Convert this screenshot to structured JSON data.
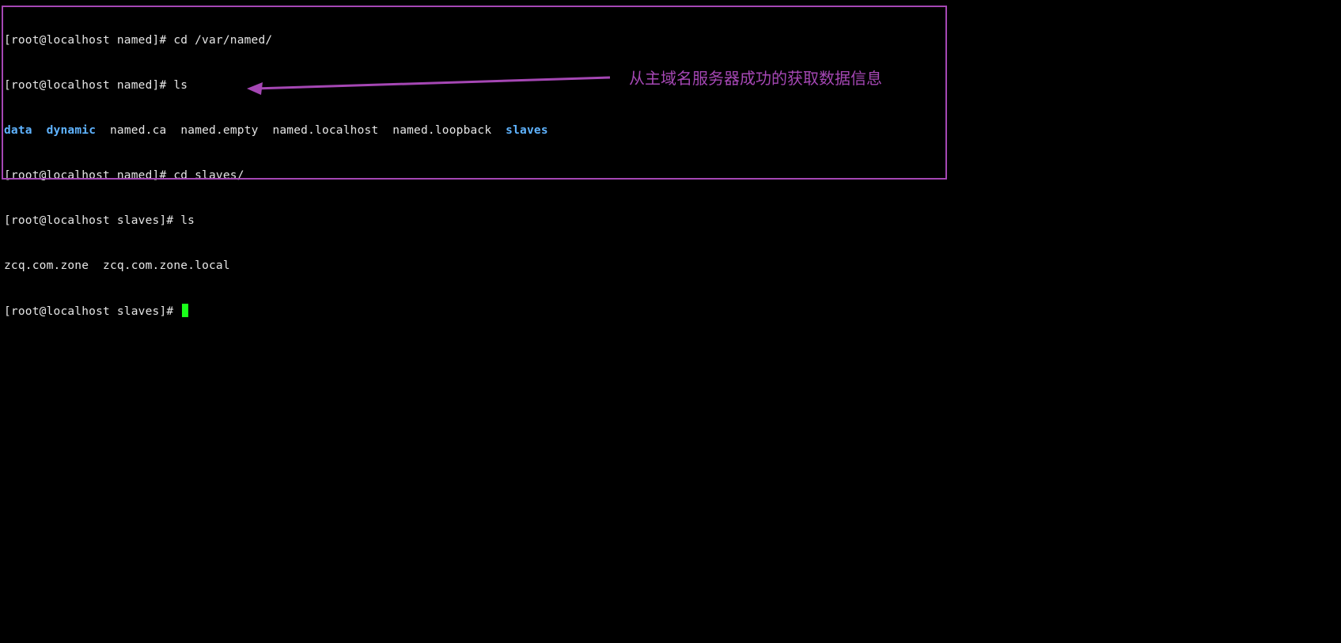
{
  "terminal": {
    "line1": {
      "prompt": "[root@localhost named]# ",
      "command": "cd /var/named/"
    },
    "line2": {
      "prompt": "[root@localhost named]# ",
      "command": "ls"
    },
    "line3": {
      "dir_data": "data",
      "dir_dynamic": "dynamic",
      "file_ca": "named.ca",
      "file_empty": "named.empty",
      "file_localhost": "named.localhost",
      "file_loopback": "named.loopback",
      "dir_slaves": "slaves"
    },
    "line4": {
      "prompt": "[root@localhost named]# ",
      "command": "cd slaves/"
    },
    "line5": {
      "prompt": "[root@localhost slaves]# ",
      "command": "ls"
    },
    "line6": {
      "file_zone": "zcq.com.zone",
      "file_zone_local": "zcq.com.zone.local"
    },
    "line7": {
      "prompt": "[root@localhost slaves]# "
    }
  },
  "annotation": {
    "text": "从主域名服务器成功的获取数据信息",
    "color": "#a547b4"
  },
  "colors": {
    "background": "#000000",
    "text": "#e6e6e6",
    "directory": "#5fb3ff",
    "cursor": "#1aff1a",
    "highlight": "#a547b4"
  }
}
